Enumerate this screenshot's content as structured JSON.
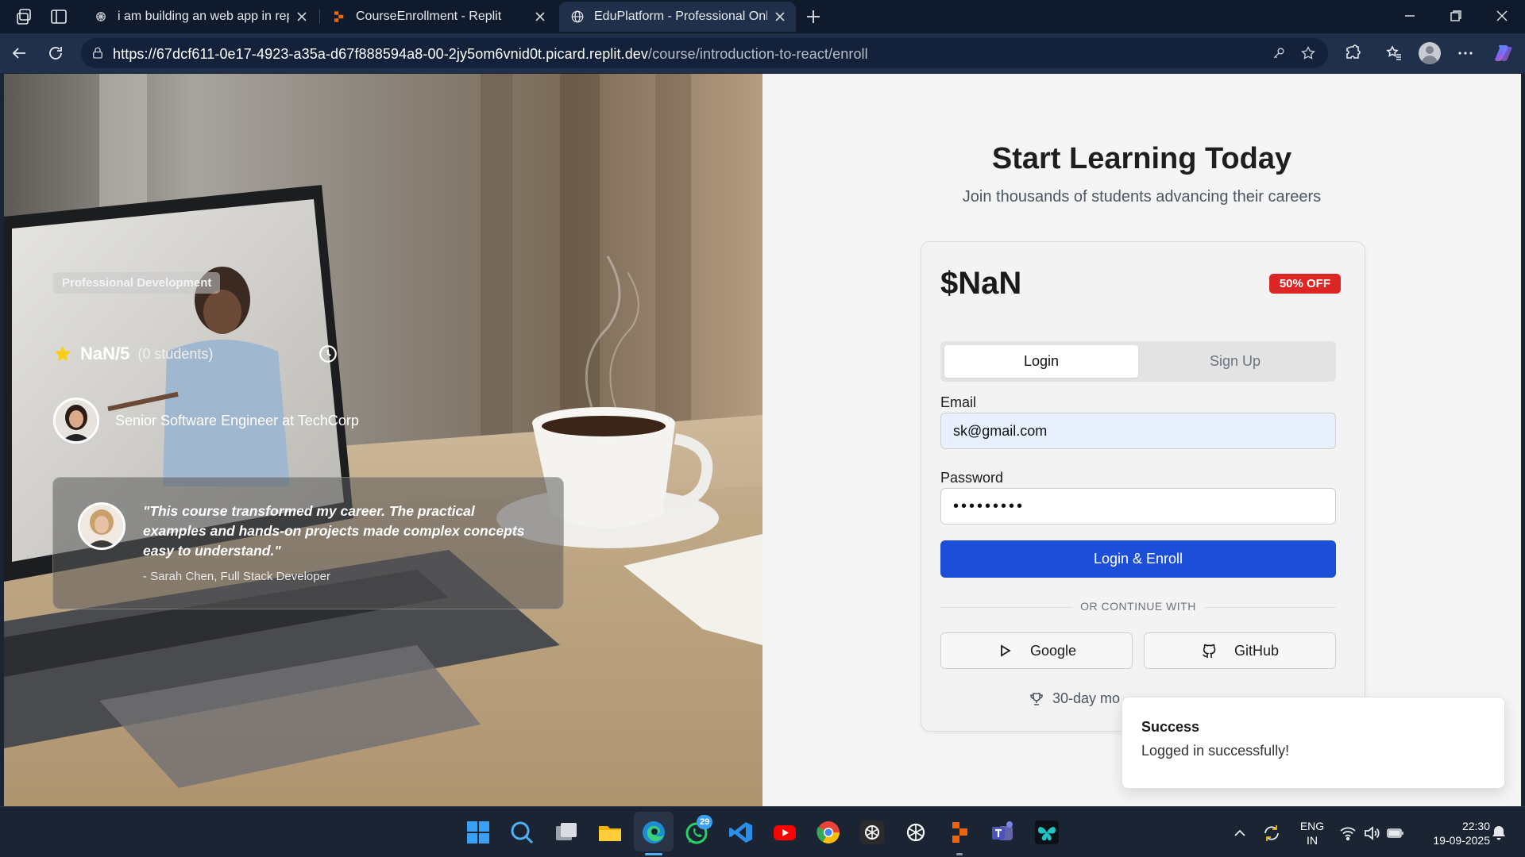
{
  "browser": {
    "tabs": [
      {
        "title": "i am building an web app in replit",
        "active": false
      },
      {
        "title": "CourseEnrollment - Replit",
        "active": false
      },
      {
        "title": "EduPlatform - Professional Online",
        "active": true
      }
    ],
    "url_host": "https://67dcf611-0e17-4923-a35a-d67f888594a8-00-2jy5om6vnid0t.picard.replit.dev",
    "url_path": "/course/introduction-to-react/enroll"
  },
  "hero": {
    "badge": "Professional Development",
    "rating": "NaN/5",
    "students": "(0 students)",
    "instructor_role": "Senior Software Engineer at TechCorp",
    "testimonial_quote": "\"This course transformed my career. The practical examples and hands-on projects made complex concepts easy to understand.\"",
    "testimonial_author": "- Sarah Chen, Full Stack Developer"
  },
  "enroll": {
    "heading": "Start Learning Today",
    "subheading": "Join thousands of students advancing their careers",
    "price": "$NaN",
    "discount": "50% OFF",
    "tab_login": "Login",
    "tab_signup": "Sign Up",
    "email_label": "Email",
    "email_value": "sk@gmail.com",
    "password_label": "Password",
    "password_value": "•••••••••",
    "submit_label": "Login & Enroll",
    "divider": "OR CONTINUE WITH",
    "google": "Google",
    "github": "GitHub",
    "guarantee": "30-day mo"
  },
  "toast": {
    "title": "Success",
    "message": "Logged in successfully!"
  },
  "taskbar": {
    "whatsapp_badge": "29",
    "lang_top": "ENG",
    "lang_bottom": "IN",
    "time": "22:30",
    "date": "19-09-2025"
  },
  "colors": {
    "primary_button": "#1d4ed8",
    "discount_badge": "#dc2626",
    "browser_frame": "#0f1b2d"
  }
}
